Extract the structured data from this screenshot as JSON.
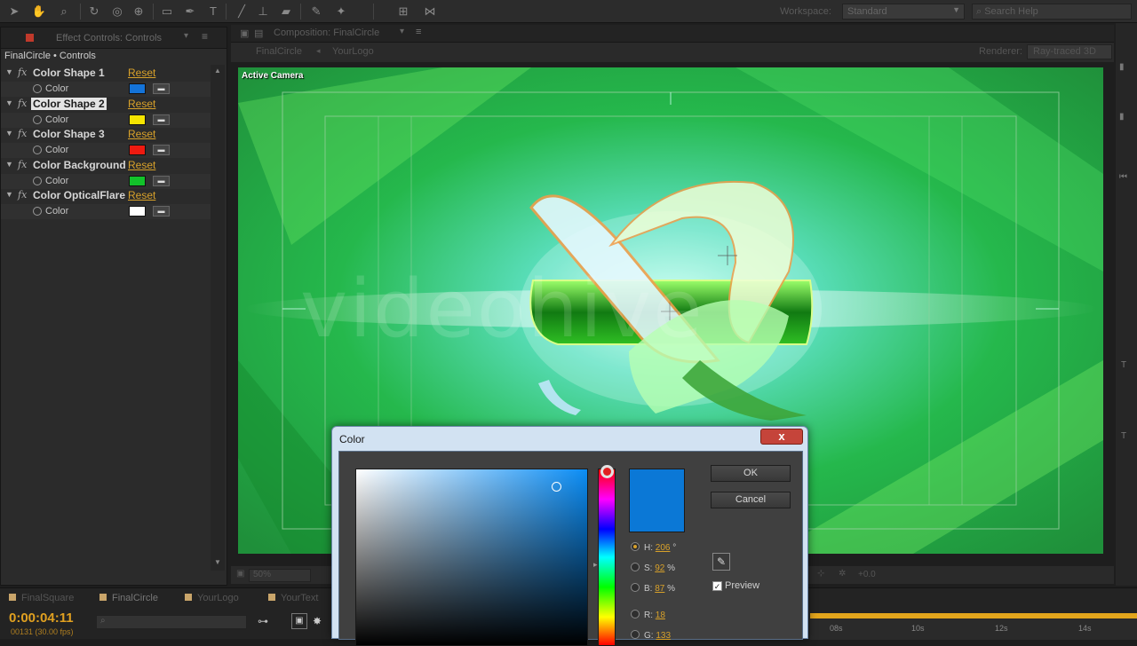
{
  "toolbar": {
    "workspace_label": "Workspace:",
    "workspace_value": "Standard",
    "search_placeholder": "Search Help"
  },
  "effect_controls": {
    "tab_title": "Effect Controls: Controls",
    "path": "FinalCircle • Controls",
    "effects": [
      {
        "name": "Color Shape 1",
        "reset": "Reset",
        "param": "Color",
        "color": "#1473d8",
        "selected": false
      },
      {
        "name": "Color Shape 2",
        "reset": "Reset",
        "param": "Color",
        "color": "#f5e400",
        "selected": true
      },
      {
        "name": "Color Shape 3",
        "reset": "Reset",
        "param": "Color",
        "color": "#ee1a10",
        "selected": false
      },
      {
        "name": "Color Background",
        "reset": "Reset",
        "param": "Color",
        "color": "#12c22a",
        "selected": false
      },
      {
        "name": "Color OpticalFlare",
        "reset": "Reset",
        "param": "Color",
        "color": "#ffffff",
        "selected": false
      }
    ]
  },
  "composition": {
    "tab_title": "Composition: FinalCircle",
    "tabs": [
      "FinalCircle",
      "YourLogo"
    ],
    "renderer_label": "Renderer:",
    "renderer_value": "Ray-traced 3D",
    "view_label": "Active Camera",
    "watermark": "videohive",
    "zoom": "50%",
    "exposure": "+0.0"
  },
  "timeline": {
    "tabs": [
      "FinalSquare",
      "FinalCircle",
      "YourLogo",
      "YourText"
    ],
    "timecode": "0:00:04:11",
    "frame_info": "00131 (30.00 fps)",
    "ruler_labels": [
      "08s",
      "10s",
      "12s",
      "14s"
    ]
  },
  "color_dialog": {
    "title": "Color",
    "close": "x",
    "ok": "OK",
    "cancel": "Cancel",
    "preview": "Preview",
    "selected_color": "#0b78d6",
    "fields": [
      {
        "label": "H:",
        "value": "206",
        "unit": "°",
        "checked": true
      },
      {
        "label": "S:",
        "value": "92",
        "unit": "%",
        "checked": false
      },
      {
        "label": "B:",
        "value": "87",
        "unit": "%",
        "checked": false
      },
      {
        "label": "R:",
        "value": "18",
        "unit": "",
        "checked": false
      },
      {
        "label": "G:",
        "value": "133",
        "unit": "",
        "checked": false
      }
    ]
  }
}
